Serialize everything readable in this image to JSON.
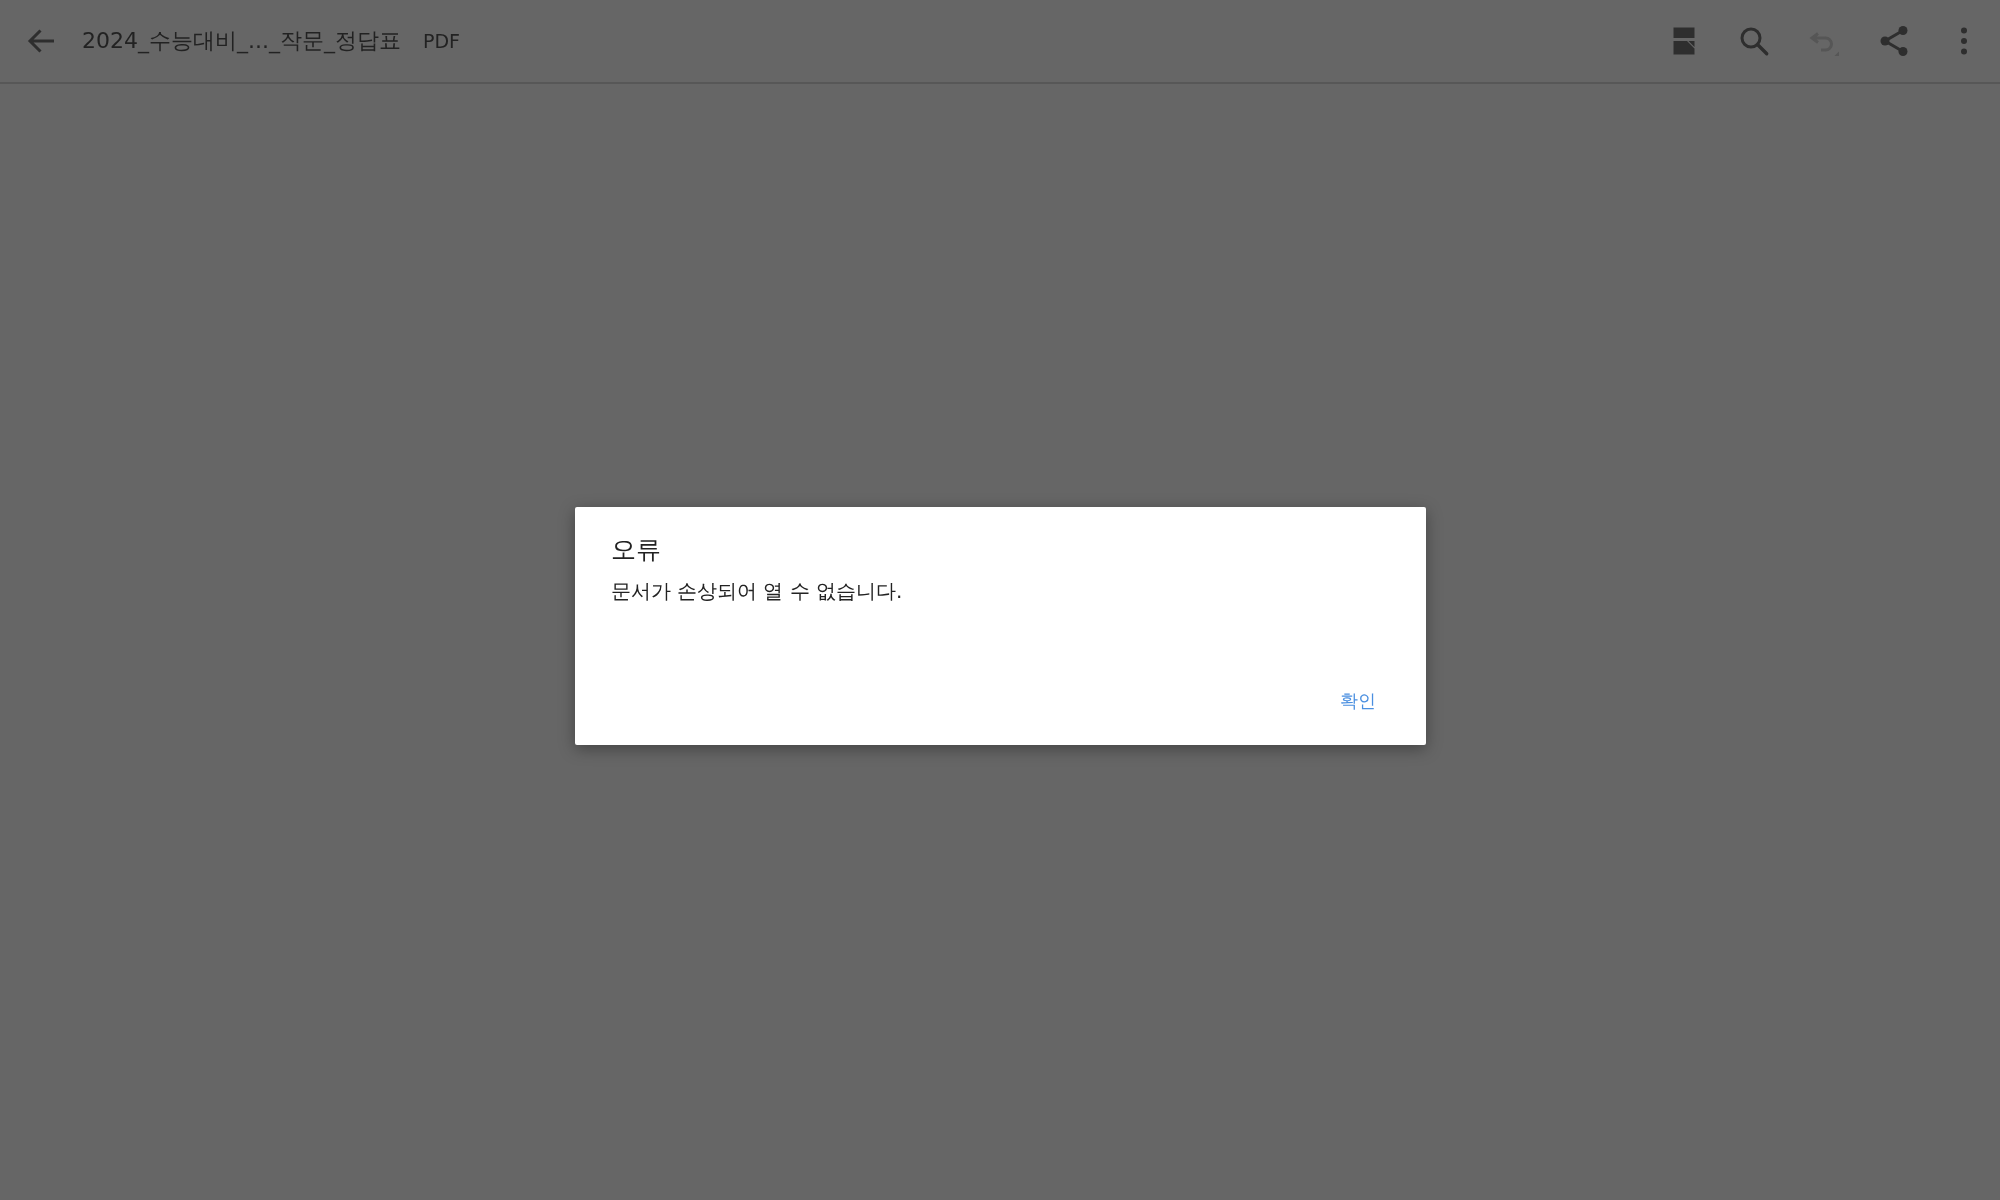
{
  "app_bar": {
    "title": "2024_수능대비_..._작문_정답표",
    "file_type": "PDF",
    "actions": [
      {
        "kind": "reading-mode",
        "disabled": false
      },
      {
        "kind": "search",
        "disabled": false
      },
      {
        "kind": "undo",
        "disabled": true
      },
      {
        "kind": "share",
        "disabled": false
      },
      {
        "kind": "more",
        "disabled": false
      }
    ]
  },
  "dialog": {
    "title": "오류",
    "message": "문서가 손상되어 열 수 없습니다.",
    "buttons": [
      "확인"
    ]
  }
}
